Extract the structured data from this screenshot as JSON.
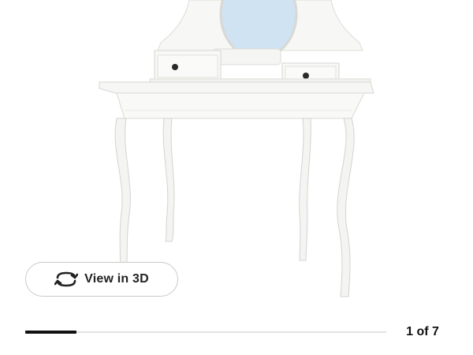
{
  "gallery": {
    "image_subject": "white-dressing-table-with-oval-mirror",
    "view3d_label": "View in 3D",
    "view3d_icon": "rotate-arrows-icon",
    "page_counter": "1 of 7",
    "current_image": 1,
    "total_images": 7
  },
  "colors": {
    "progress_fill": "#111111",
    "progress_track": "#e3e3e3",
    "button_border": "#c9c9c9"
  }
}
